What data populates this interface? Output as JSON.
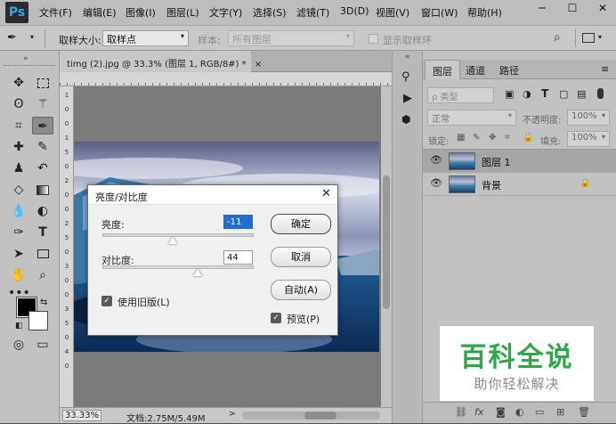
{
  "app": {
    "logo": "Ps"
  },
  "menu": [
    "文件(F)",
    "编辑(E)",
    "图像(I)",
    "图层(L)",
    "文字(Y)",
    "选择(S)",
    "滤镜(T)",
    "3D(D)",
    "视图(V)",
    "窗口(W)",
    "帮助(H)"
  ],
  "window_controls": {
    "minimize": "─",
    "maximize": "☐",
    "close": "✕"
  },
  "options": {
    "sample_size_label": "取样大小:",
    "sample_size_value": "取样点",
    "sample_label": "样本:",
    "sample_value": "所有图层",
    "show_ring_label": "显示取样环"
  },
  "document": {
    "tab_title": "timg (2).jpg @ 33.3% (图层 1, RGB/8#) *",
    "tab_close": "×",
    "zoom": "33.33%",
    "doc_info": "文档:2.75M/5.49M",
    "ruler_left_marks": [
      "1",
      "0",
      "0",
      "1",
      "5",
      "0",
      "2",
      "0",
      "0",
      "2",
      "5",
      "0",
      "3",
      "0",
      "0",
      "3",
      "5",
      "0",
      "4",
      "0"
    ]
  },
  "layers_panel": {
    "tabs": [
      "图层",
      "通道",
      "路径"
    ],
    "filter_label": "ρ 类型",
    "blend_mode": "正常",
    "opacity_label": "不透明度:",
    "opacity_value": "100%",
    "lock_label": "锁定:",
    "fill_label": "填充:",
    "fill_value": "100%",
    "layers": [
      {
        "name": "图层 1",
        "selected": true
      },
      {
        "name": "背景",
        "selected": false,
        "locked": true
      }
    ]
  },
  "dialog": {
    "title": "亮度/对比度",
    "brightness_label": "亮度:",
    "brightness_value": "-11",
    "brightness_level": -11,
    "contrast_label": "对比度:",
    "contrast_value": "44",
    "contrast_level": 44,
    "legacy_label": "使用旧版(L)",
    "legacy_checked": true,
    "ok_label": "确定",
    "cancel_label": "取消",
    "auto_label": "自动(A)",
    "preview_label": "预览(P)",
    "preview_checked": true
  },
  "watermark": {
    "title": "百科全说",
    "subtitle": "助你轻松解决",
    "color": "#2fa64a"
  }
}
